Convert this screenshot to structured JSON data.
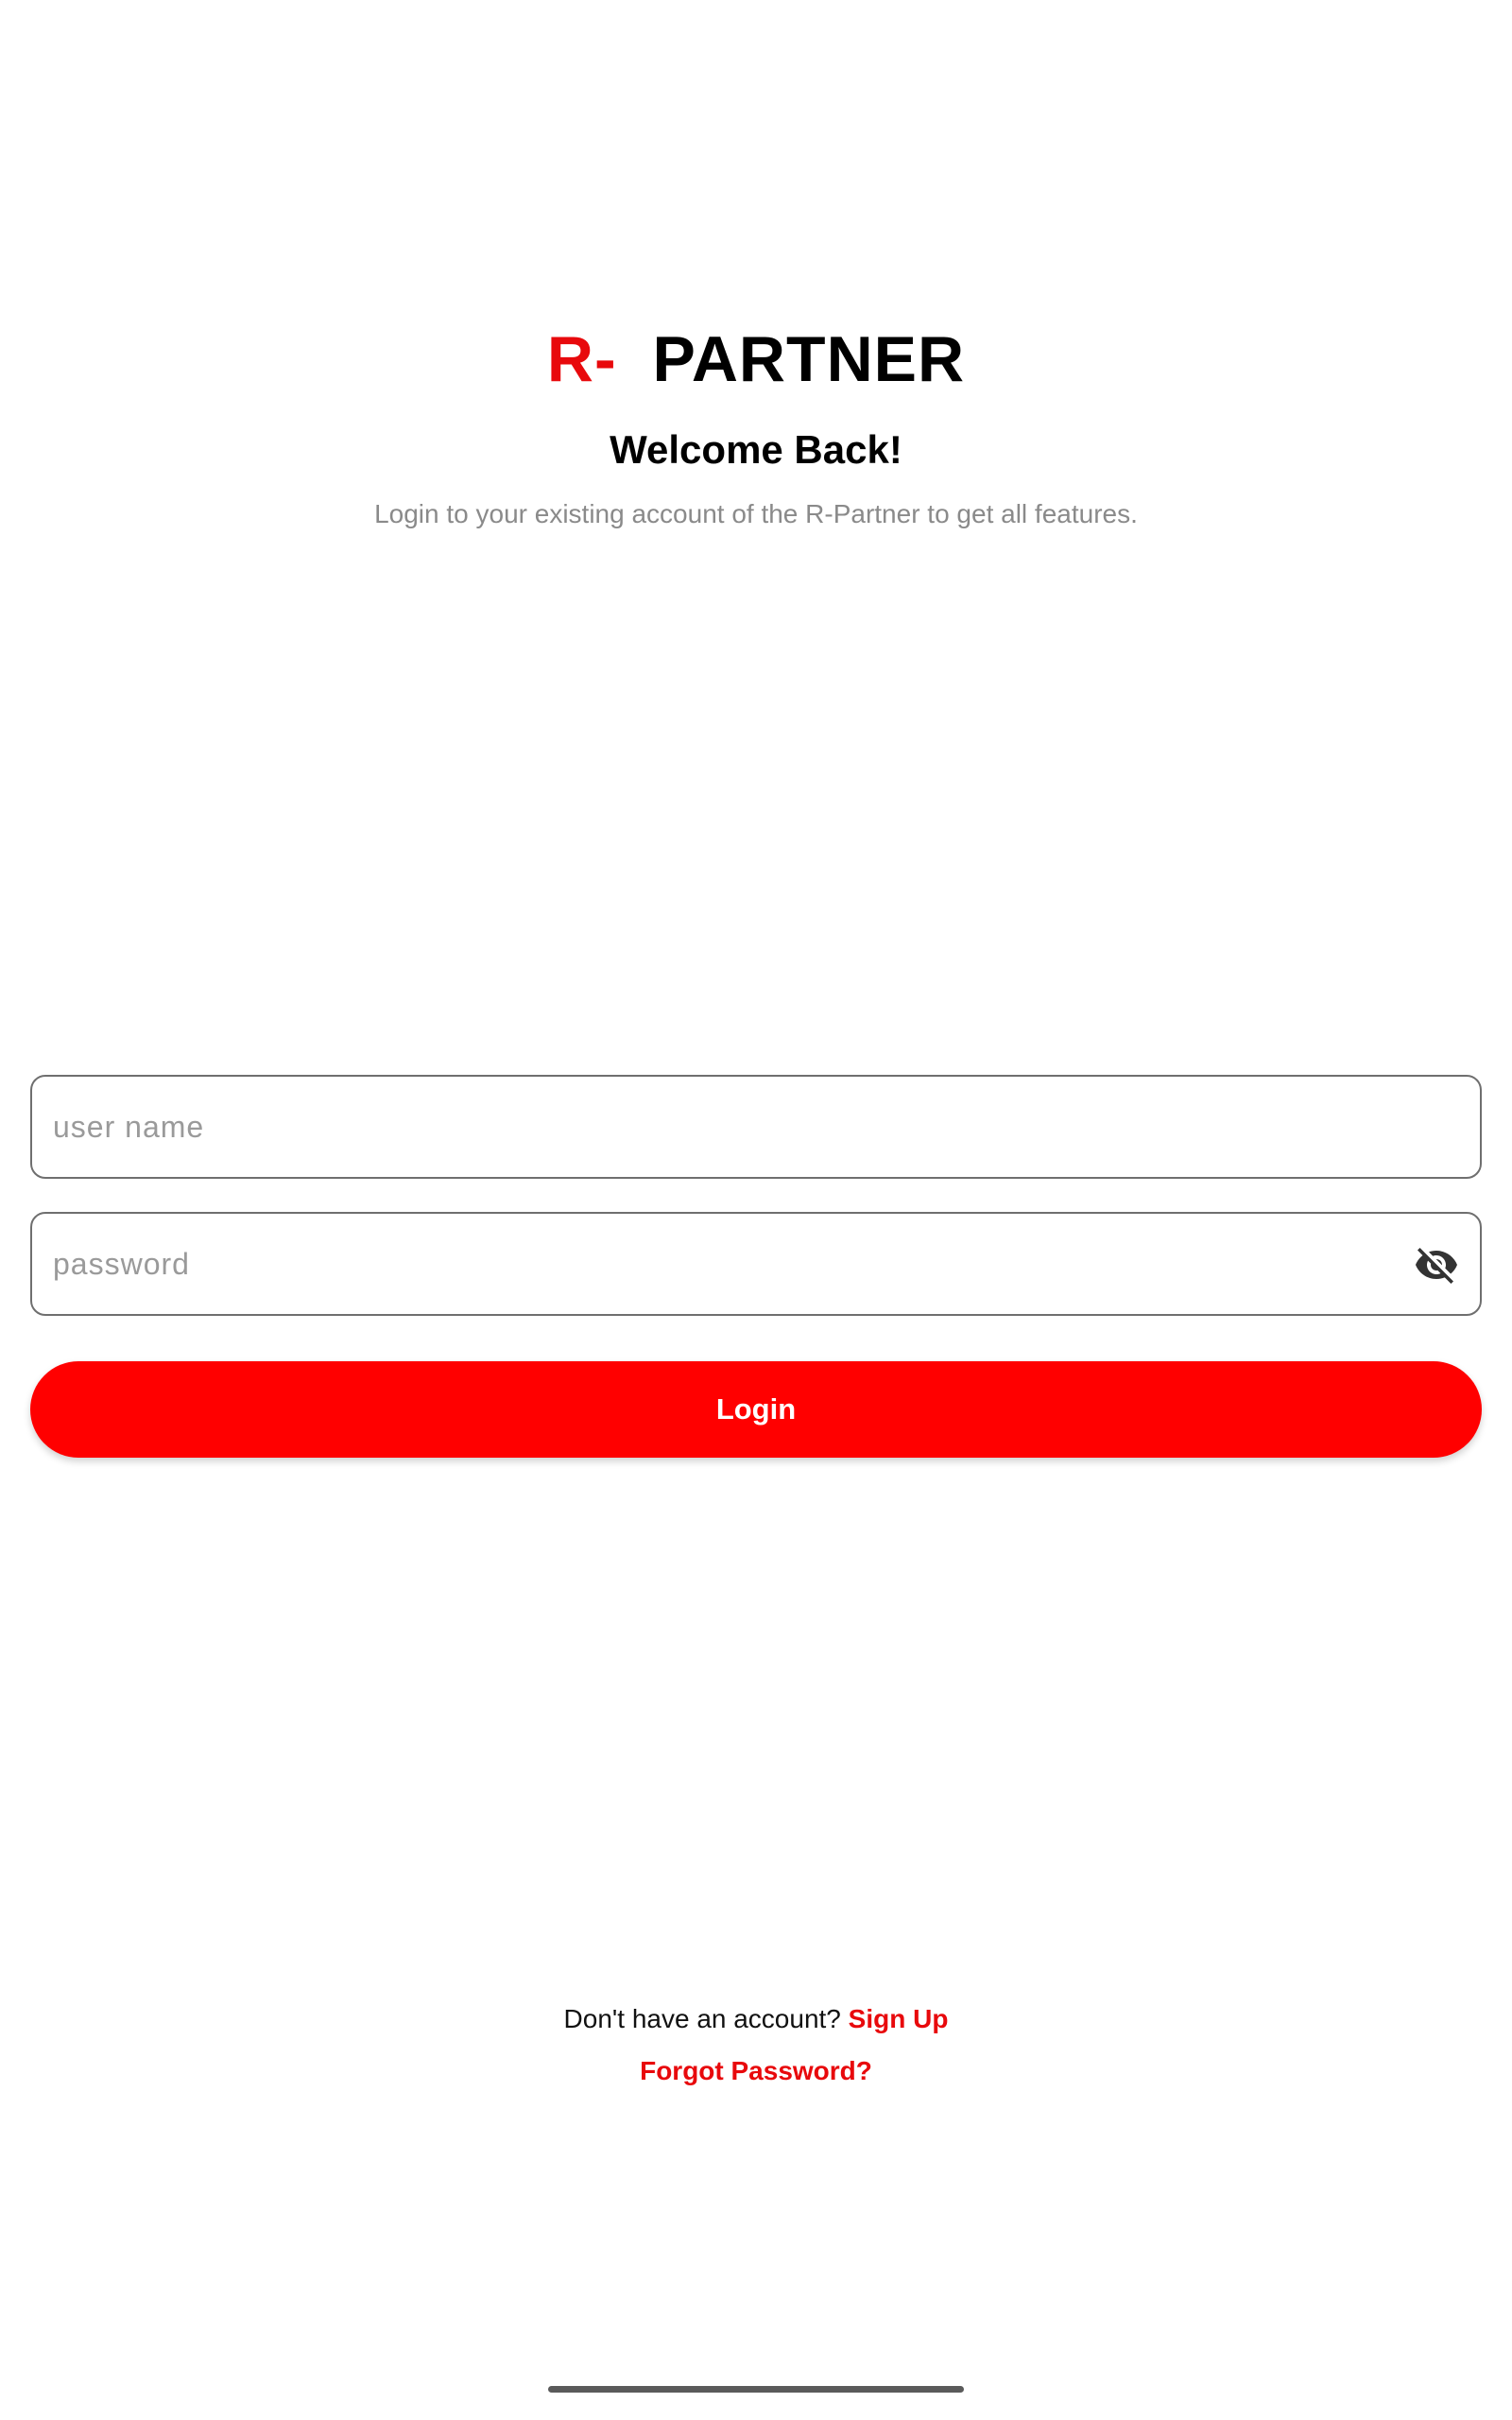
{
  "header": {
    "brand_prefix": "R-",
    "brand_name": "PARTNER",
    "welcome": "Welcome Back!",
    "subtitle": "Login to your existing account of the R-Partner to get all features."
  },
  "form": {
    "username": {
      "value": "",
      "placeholder": "user name"
    },
    "password": {
      "value": "",
      "placeholder": "password",
      "toggle_icon": "eye-off-icon"
    },
    "login_label": "Login"
  },
  "footer": {
    "signup_prompt": "Don't have an account?",
    "signup_label": "Sign Up",
    "forgot_label": "Forgot Password?"
  },
  "colors": {
    "accent": "#e8090c",
    "button": "#ff0000",
    "muted_text": "#8a8a8a",
    "border": "#6f6f6f"
  }
}
